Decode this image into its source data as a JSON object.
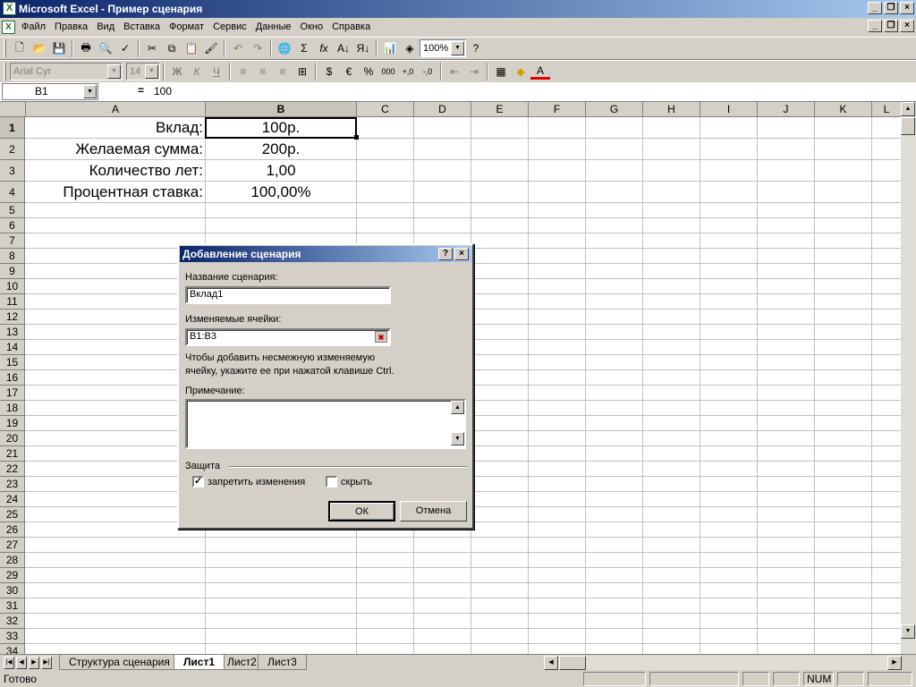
{
  "window": {
    "title": "Microsoft Excel - Пример сценария",
    "icon": "excel-icon"
  },
  "menu": [
    "Файл",
    "Правка",
    "Вид",
    "Вставка",
    "Формат",
    "Сервис",
    "Данные",
    "Окно",
    "Справка"
  ],
  "toolbar": {
    "zoom": "100%",
    "font_name": "Arial Cyr",
    "font_size": "14",
    "bold": "Ж",
    "italic": "К",
    "underline": "Ч"
  },
  "formula_bar": {
    "cell_ref": "B1",
    "equals": "=",
    "value": "100"
  },
  "columns": [
    "A",
    "B",
    "C",
    "D",
    "E",
    "F",
    "G",
    "H",
    "I",
    "J",
    "K",
    "L"
  ],
  "rows": [
    "1",
    "2",
    "3",
    "4",
    "5",
    "6",
    "7",
    "8",
    "9",
    "10",
    "11",
    "12",
    "13",
    "14",
    "15",
    "16",
    "17",
    "18",
    "19",
    "20",
    "21",
    "22",
    "23",
    "24",
    "25",
    "26",
    "27",
    "28",
    "29",
    "30",
    "31",
    "32",
    "33",
    "34"
  ],
  "cells": {
    "a1": "Вклад:",
    "b1": "100р.",
    "a2": "Желаемая сумма:",
    "b2": "200р.",
    "a3": "Количество лет:",
    "b3": "1,00",
    "a4": "Процентная ставка:",
    "b4": "100,00%"
  },
  "sheet_tabs": [
    "Структура сценария",
    "Лист1",
    "Лист2",
    "Лист3"
  ],
  "active_tab": "Лист1",
  "status": {
    "text": "Готово",
    "num": "NUM"
  },
  "dialog": {
    "title": "Добавление сценария",
    "name_label": "Название сценария:",
    "name_value": "Вклад1",
    "cells_label": "Изменяемые ячейки:",
    "cells_value": "B1:B3",
    "hint_line1": "Чтобы добавить несмежную изменяемую",
    "hint_line2": "ячейку, укажите ее при нажатой клавише Ctrl.",
    "comment_label": "Примечание:",
    "comment_value": "",
    "protection_label": "Защита",
    "prevent_changes_label": "запретить изменения",
    "prevent_changes_checked": true,
    "hide_label": "скрыть",
    "hide_checked": false,
    "ok_label": "ОК",
    "cancel_label": "Отмена"
  }
}
